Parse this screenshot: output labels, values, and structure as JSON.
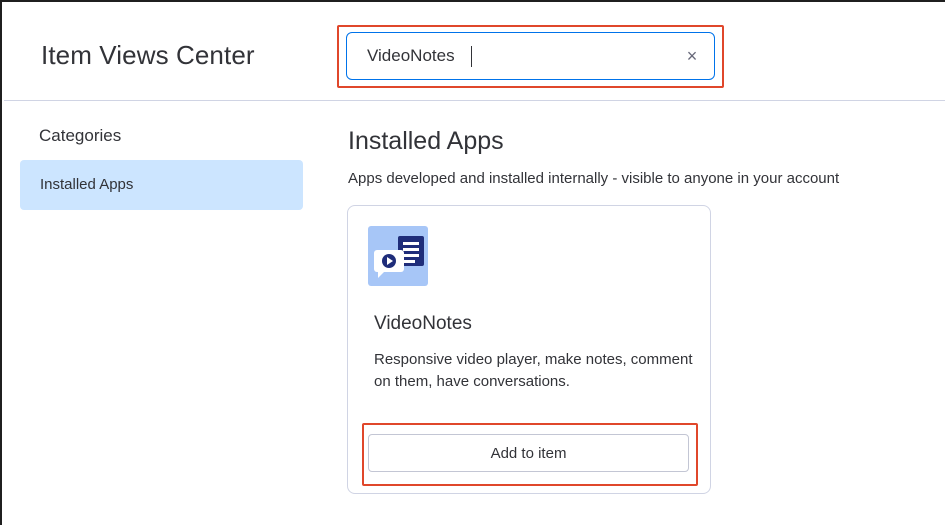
{
  "header": {
    "app_title": "Item Views Center",
    "search": {
      "value": "VideoNotes",
      "clear_icon": "×"
    }
  },
  "sidebar": {
    "heading": "Categories",
    "items": [
      {
        "label": "Installed Apps",
        "selected": true
      }
    ]
  },
  "main": {
    "title": "Installed Apps",
    "subtitle": "Apps developed and installed internally - visible to anyone in your account",
    "cards": [
      {
        "icon": "video-notes-icon",
        "name": "VideoNotes",
        "description": "Responsive video player, make notes, comment on them, have conversations.",
        "button_label": "Add to item"
      }
    ]
  },
  "colors": {
    "highlight": "#e0472b",
    "selected_bg": "#cce5ff",
    "focus_border": "#0073ea",
    "icon_bg": "#a7c6f7",
    "icon_dark": "#1f2d7a"
  }
}
